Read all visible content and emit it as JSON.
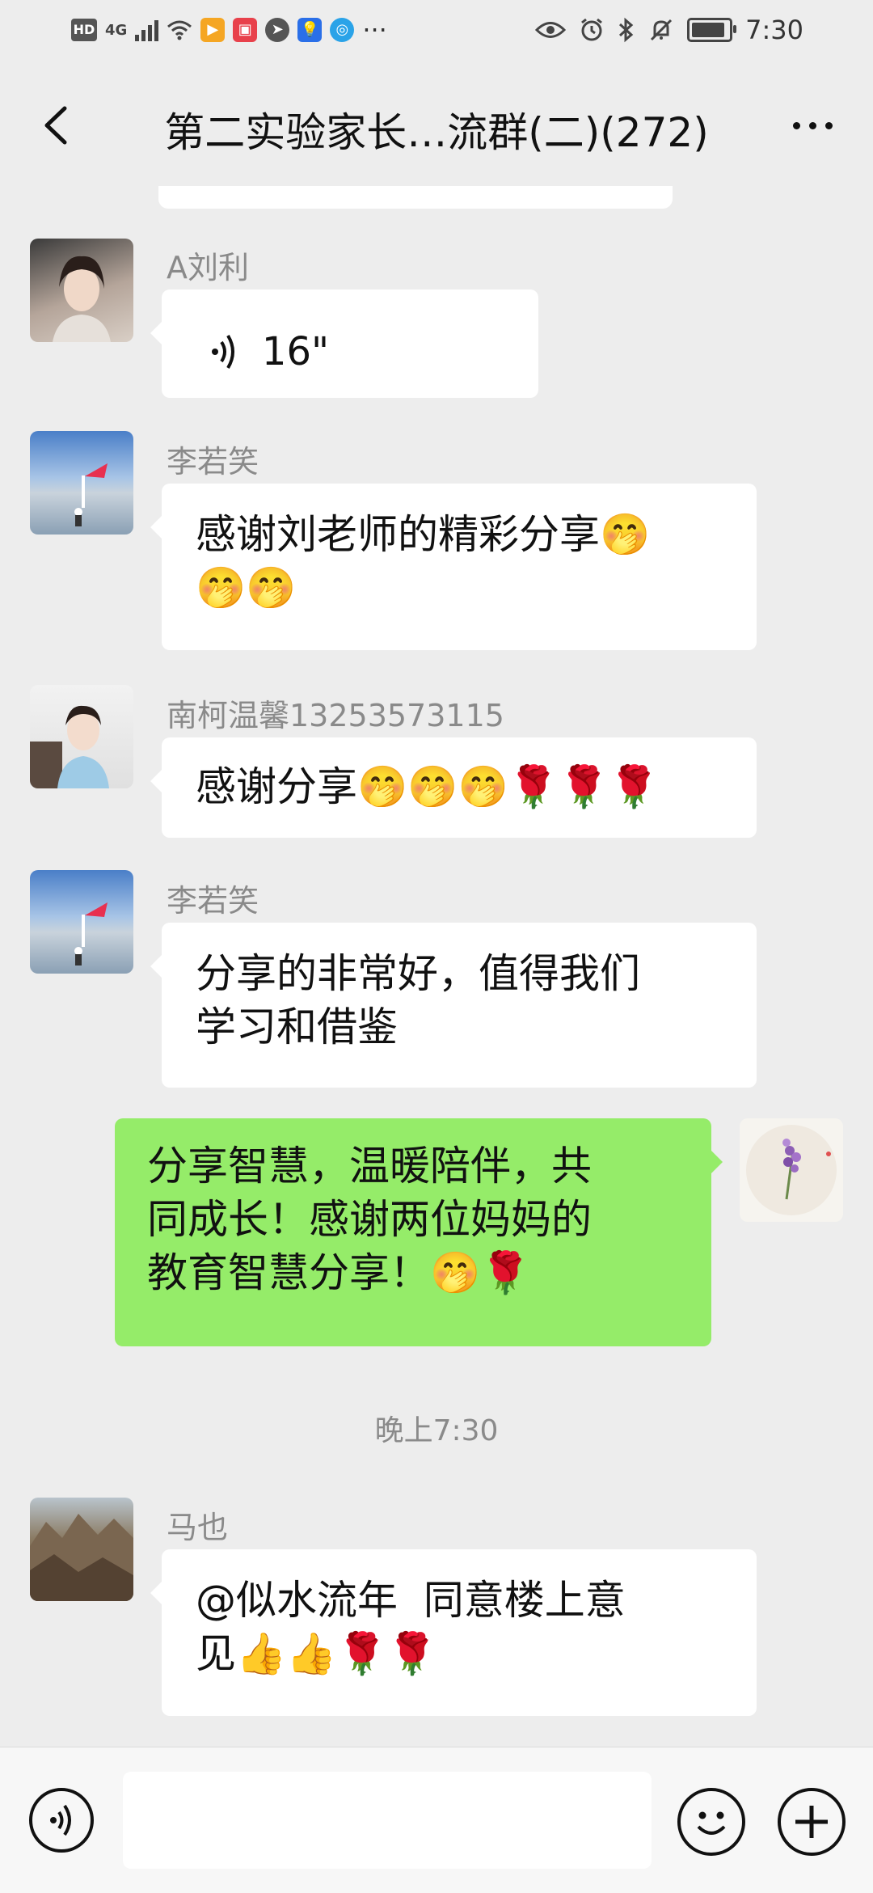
{
  "status_bar": {
    "left_badge": "HD",
    "network": "4G",
    "time": "7:30",
    "overflow": "···",
    "icons": [
      "hd-icon",
      "signal-icon",
      "wifi-icon",
      "video-app-icon",
      "red-app-icon",
      "compass-app-icon",
      "bulb-app-icon",
      "browser-app-icon",
      "more-icon",
      "eye-icon",
      "alarm-icon",
      "bluetooth-icon",
      "mute-icon",
      "battery-icon"
    ]
  },
  "header": {
    "title": "第二实验家长…流群(二)(272)",
    "back_icon": "chevron-left-icon",
    "more_icon": "more-dots-icon"
  },
  "messages": [
    {
      "sender": "A刘利",
      "type": "voice",
      "voice_duration": "16\"",
      "side": "left"
    },
    {
      "sender": "李若笑",
      "type": "text",
      "text": "感谢刘老师的精彩分享🤭\n🤭🤭",
      "side": "left"
    },
    {
      "sender": "南柯温馨13253573115",
      "type": "text",
      "text": "感谢分享🤭🤭🤭🌹🌹🌹",
      "side": "left"
    },
    {
      "sender": "李若笑",
      "type": "text",
      "text": "分享的非常好，值得我们\n学习和借鉴",
      "side": "left"
    },
    {
      "sender": "",
      "type": "text",
      "text": "分享智慧，温暖陪伴，共\n同成长！感谢两位妈妈的\n教育智慧分享！🤭🌹",
      "side": "right"
    },
    {
      "sender": "马也",
      "type": "text",
      "text": "@似水流年  同意楼上意\n见👍👍🌹🌹",
      "side": "left"
    }
  ],
  "time_divider": "晚上7:30",
  "input_bar": {
    "voice_icon": "voice-toggle-icon",
    "emoji_icon": "emoji-icon",
    "plus_icon": "plus-icon",
    "input_value": ""
  },
  "colors": {
    "background": "#ededed",
    "self_bubble": "#95ec69",
    "other_bubble": "#ffffff",
    "name_text": "#8a8a8a"
  }
}
